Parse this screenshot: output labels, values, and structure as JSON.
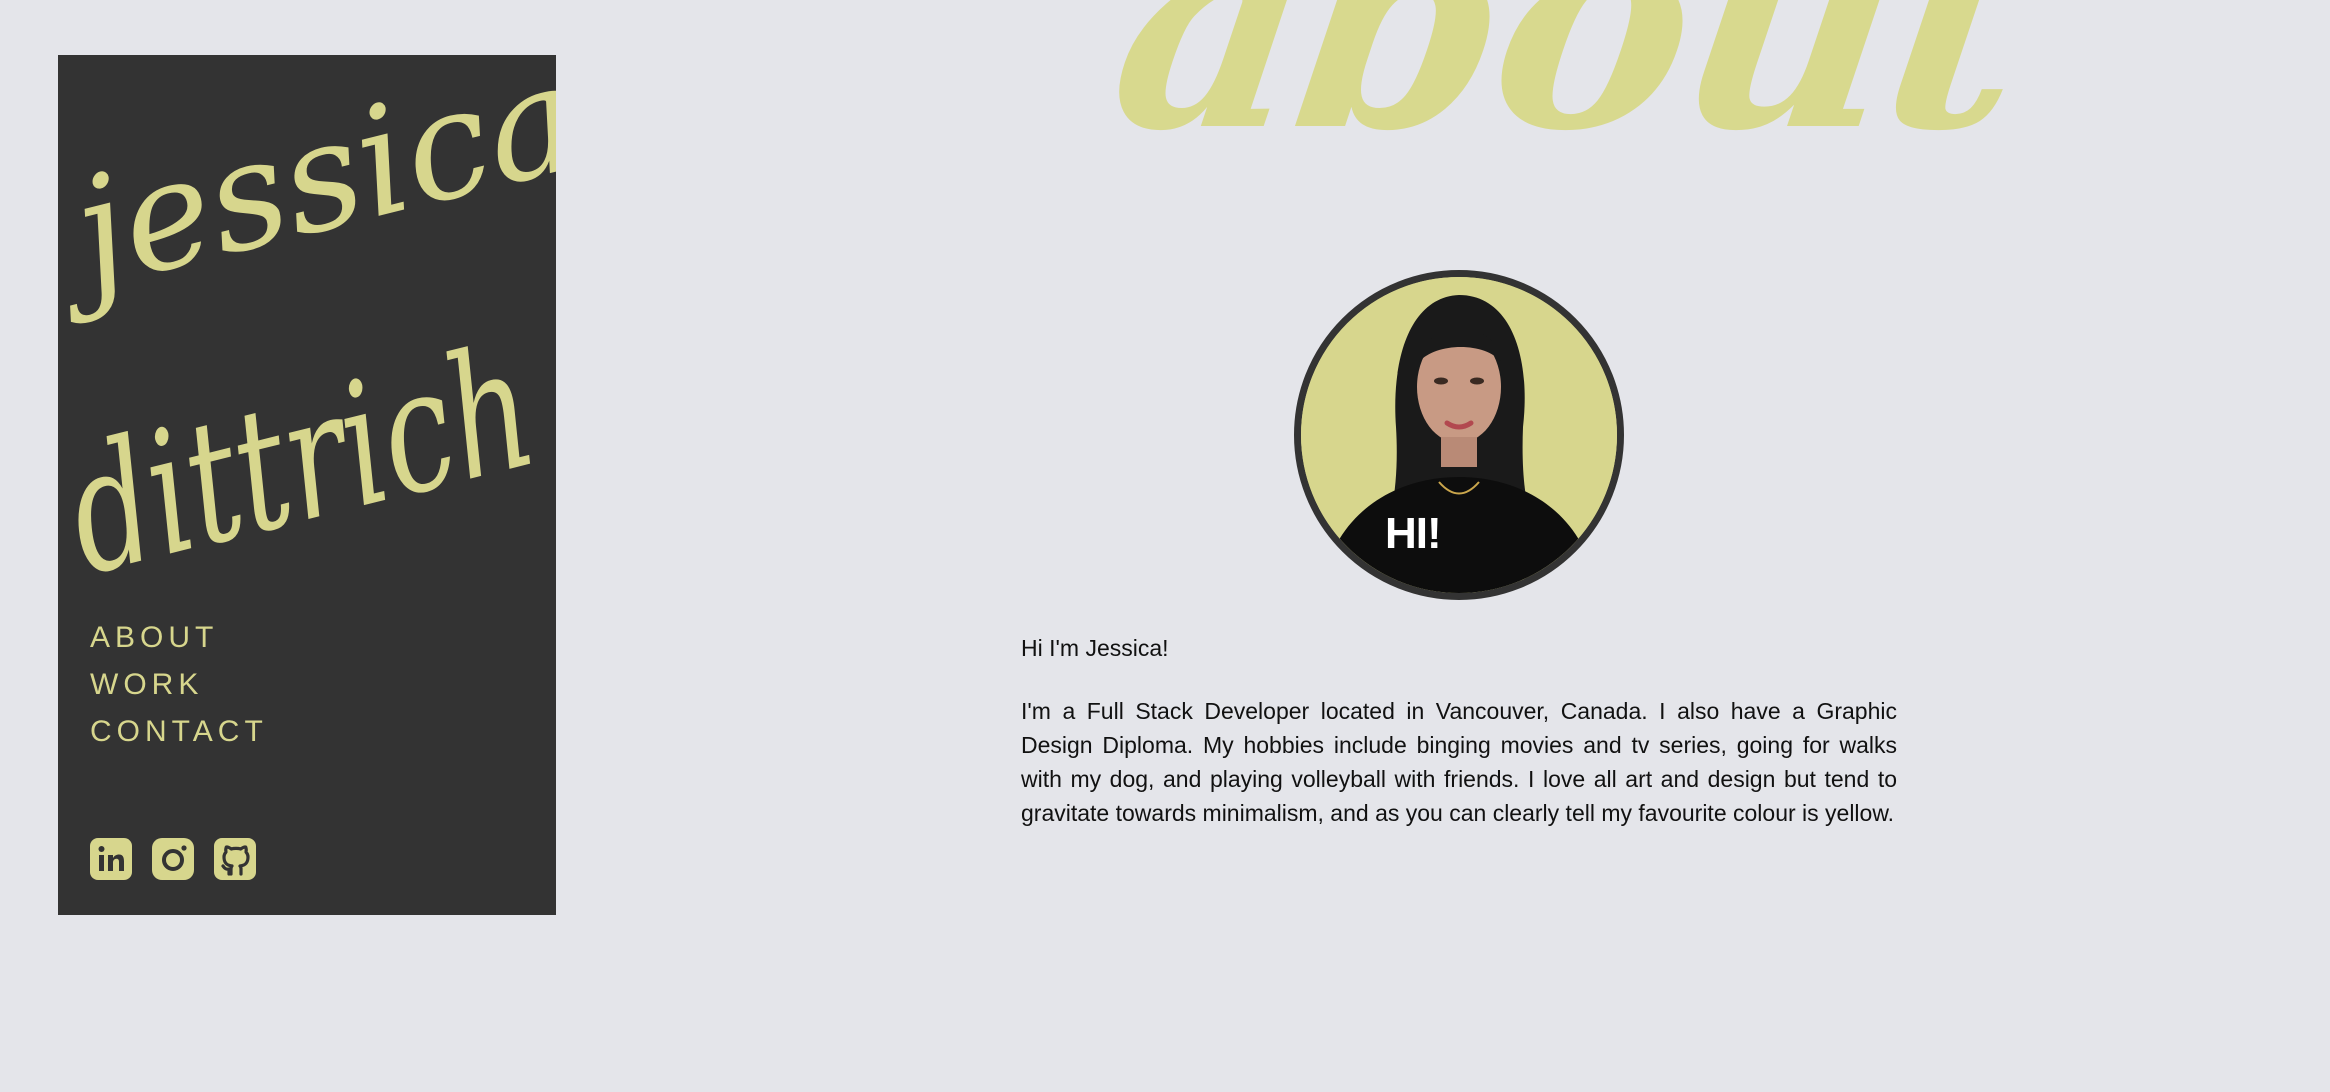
{
  "logo": {
    "line1": "jessica",
    "line2": "dittrich"
  },
  "nav": {
    "items": [
      {
        "label": "ABOUT"
      },
      {
        "label": "WORK"
      },
      {
        "label": "CONTACT"
      }
    ]
  },
  "socials": [
    {
      "icon": "linkedin-icon"
    },
    {
      "icon": "instagram-icon"
    },
    {
      "icon": "github-icon"
    }
  ],
  "section": {
    "title": "about"
  },
  "avatar": {
    "caption": "HI!"
  },
  "content": {
    "greeting": "Hi I'm Jessica!",
    "bio": "I'm a Full Stack Developer located in Vancouver, Canada. I also have a Graphic Design Diploma. My hobbies include binging movies and tv series, going for walks with my dog, and playing volleyball with friends. I love all art and design but tend to gravitate towards minimalism, and as you can clearly tell my favourite colour is yellow."
  },
  "colors": {
    "accent": "#d7d68d",
    "sidebar": "#333333",
    "background": "#e4e5ea",
    "text": "#111111"
  }
}
